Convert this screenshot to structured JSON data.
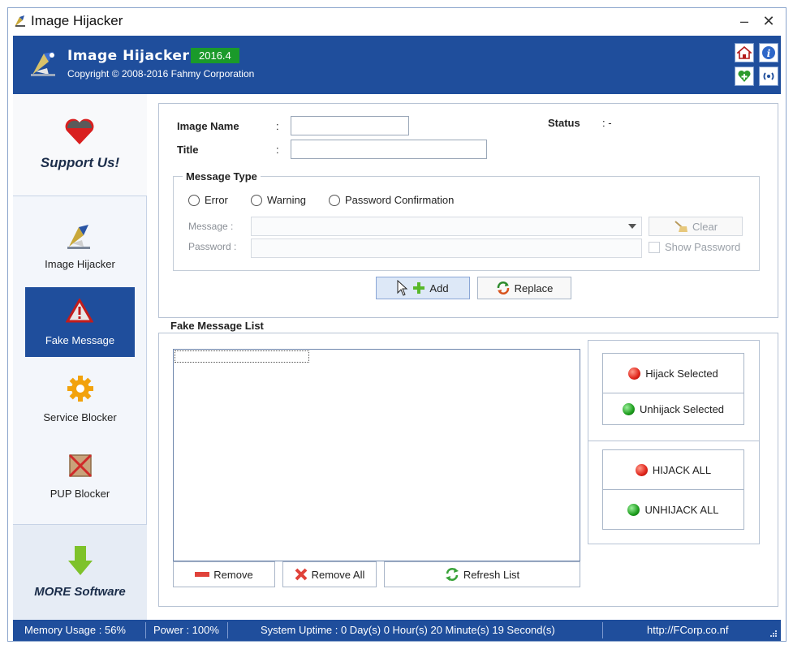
{
  "window": {
    "title": "Image Hijacker",
    "minimize": "–",
    "close": "✕"
  },
  "header": {
    "app_name": "Image Hijacker",
    "version": "2016.4",
    "copyright": "Copyright © 2008-2016 Fahmy Corporation",
    "buttons": [
      "home-icon",
      "info-icon",
      "donate-icon",
      "web-icon"
    ]
  },
  "sidebar": {
    "support": "Support Us!",
    "items": [
      {
        "label": "Image Hijacker",
        "icon": "hijacker-icon"
      },
      {
        "label": "Fake Message",
        "icon": "warning-icon",
        "active": true
      },
      {
        "label": "Service Blocker",
        "icon": "gear-icon"
      },
      {
        "label": "PUP Blocker",
        "icon": "pup-icon"
      }
    ],
    "more": "MORE Software"
  },
  "form": {
    "image_name_label": "Image Name",
    "title_label": "Title",
    "colon": ":",
    "image_name_value": "",
    "title_value": "",
    "status_label": "Status",
    "status_value": ": -",
    "message_type": {
      "title": "Message Type",
      "options": [
        "Error",
        "Warning",
        "Password Confirmation"
      ],
      "message_label": "Message :",
      "password_label": "Password :",
      "message_value": "",
      "password_value": "",
      "clear_label": "Clear",
      "show_password_label": "Show Password"
    },
    "add_label": "Add",
    "replace_label": "Replace"
  },
  "list_panel": {
    "title": "Fake Message List",
    "items": [],
    "hijack_selected": "Hijack Selected",
    "unhijack_selected": "Unhijack Selected",
    "hijack_all": "HIJACK ALL",
    "unhijack_all": "UNHIJACK ALL",
    "remove": "Remove",
    "remove_all": "Remove All",
    "refresh_list": "Refresh List"
  },
  "status_bar": {
    "memory": "Memory Usage : 56%",
    "power": "Power : 100%",
    "uptime": "System Uptime : 0 Day(s) 0 Hour(s) 20 Minute(s) 19 Second(s)",
    "url": "http://FCorp.co.nf"
  },
  "colors": {
    "accent": "#1f4e9c",
    "version_badge": "#1a9a2a",
    "status_bar": "#1f4e9c"
  }
}
